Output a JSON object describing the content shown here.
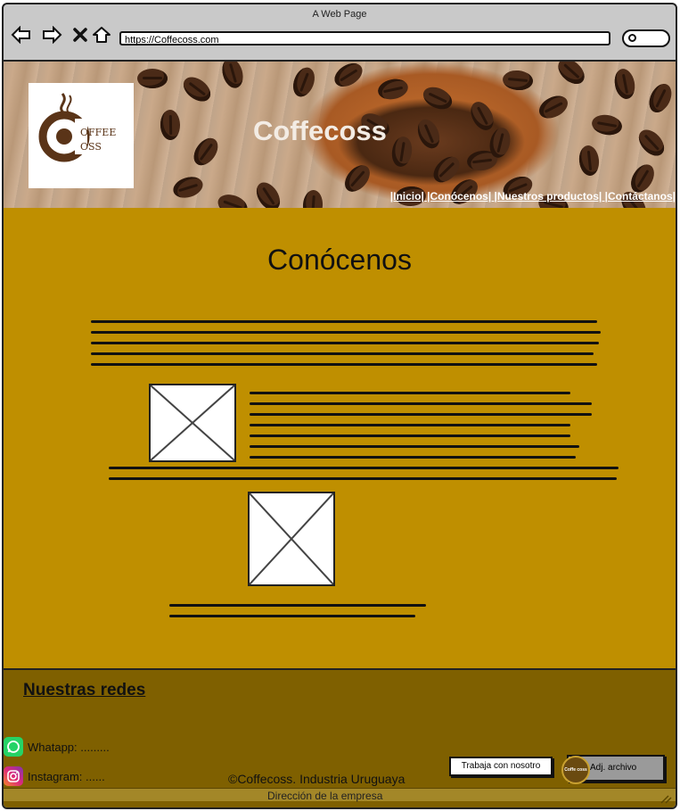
{
  "browser": {
    "window_title": "A Web Page",
    "url": "https://Coffecoss.com",
    "nav_icons": [
      "back-arrow-icon",
      "forward-arrow-icon",
      "stop-icon",
      "home-icon"
    ]
  },
  "header": {
    "brand": "Coffecoss",
    "logo_text_1": "OFFEE",
    "logo_text_2": "OSS",
    "menu": "|Inicio| |Conócenos| |Nuestros productos| |Contáctanos|"
  },
  "main": {
    "title": "Conócenos"
  },
  "footer": {
    "title": "Nuestras redes",
    "whatsapp": "Whatapp: .........",
    "instagram": "Instagram: ......",
    "copyright": "©Coffecoss. Industria Uruguaya",
    "address": "Dirección de la empresa",
    "work_button": "Trabaja con nosotro",
    "attach_button": "Adj. archivo",
    "attach_logo_text": "Coffe coss"
  },
  "colors": {
    "content_bg": "#bf8f00",
    "footer_bg": "#7f6000",
    "whatsapp": "#25d366",
    "instagram": "#c13584"
  }
}
